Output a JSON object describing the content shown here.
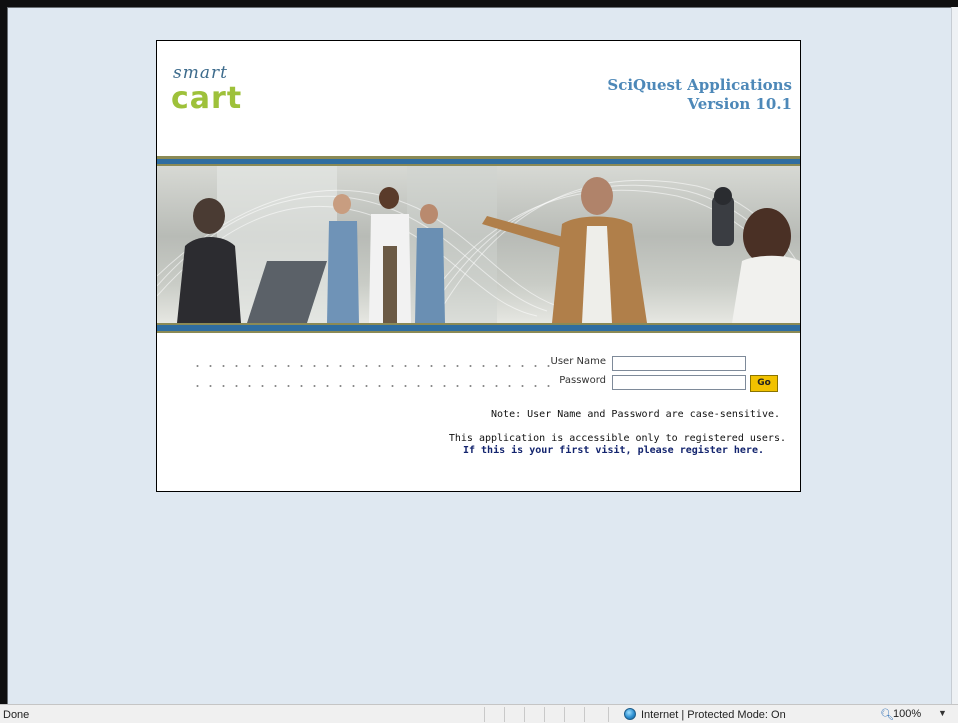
{
  "header": {
    "logo_top": "smart",
    "logo_bottom": "cart",
    "app_name": "SciQuest Applications",
    "version": "Version 10.1"
  },
  "login": {
    "username_label": "User Name",
    "password_label": "Password",
    "username_value": "",
    "password_value": "",
    "go_label": "Go",
    "note": "Note: User Name and Password are case-sensitive.",
    "access_text": "This application is accessible only to registered users.",
    "register_link": "If this is your first visit, please register here."
  },
  "statusbar": {
    "status": "Done",
    "zone": "Internet | Protected Mode: On",
    "zoom": "100%"
  },
  "colors": {
    "page_bg": "#dfe8f1",
    "title_blue": "#4d88b8",
    "logo_green": "#9ec13a",
    "banner_blue": "#2f6da0",
    "go_yellow": "#f2c200",
    "link_navy": "#13246e"
  }
}
